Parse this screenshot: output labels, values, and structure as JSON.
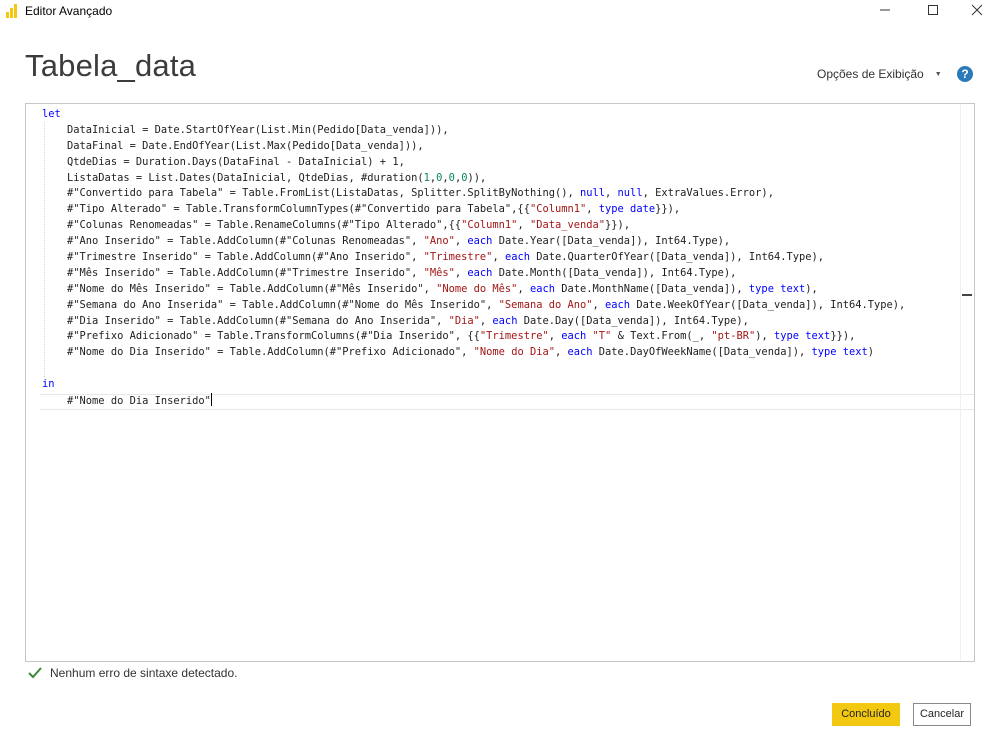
{
  "window": {
    "title": "Editor Avançado",
    "controls": [
      "minimize",
      "maximize",
      "close"
    ]
  },
  "header": {
    "query_name": "Tabela_data",
    "display_options_label": "Opções de Exibição",
    "help_label": "?"
  },
  "editor": {
    "lines": [
      [
        {
          "t": "let",
          "c": "kw"
        }
      ],
      [
        {
          "t": "    DataInicial = Date.StartOfYear(List.Min(Pedido[Data_venda])),"
        }
      ],
      [
        {
          "t": "    DataFinal = Date.EndOfYear(List.Max(Pedido[Data_venda])),"
        }
      ],
      [
        {
          "t": "    QtdeDias = Duration.Days(DataFinal - DataInicial) + 1,"
        }
      ],
      [
        {
          "t": "    ListaDatas = List.Dates(DataInicial, QtdeDias, #duration("
        },
        {
          "t": "1",
          "c": "num"
        },
        {
          "t": ","
        },
        {
          "t": "0",
          "c": "num"
        },
        {
          "t": ","
        },
        {
          "t": "0",
          "c": "num"
        },
        {
          "t": ","
        },
        {
          "t": "0",
          "c": "num"
        },
        {
          "t": ")),"
        }
      ],
      [
        {
          "t": "    #\"Convertido para Tabela\" = Table.FromList(ListaDatas, Splitter.SplitByNothing(), "
        },
        {
          "t": "null",
          "c": "kw"
        },
        {
          "t": ", "
        },
        {
          "t": "null",
          "c": "kw"
        },
        {
          "t": ", ExtraValues.Error),"
        }
      ],
      [
        {
          "t": "    #\"Tipo Alterado\" = Table.TransformColumnTypes(#\"Convertido para Tabela\",{{"
        },
        {
          "t": "\"Column1\"",
          "c": "str"
        },
        {
          "t": ", "
        },
        {
          "t": "type date",
          "c": "kw"
        },
        {
          "t": "}}),"
        }
      ],
      [
        {
          "t": "    #\"Colunas Renomeadas\" = Table.RenameColumns(#\"Tipo Alterado\",{{"
        },
        {
          "t": "\"Column1\"",
          "c": "str"
        },
        {
          "t": ", "
        },
        {
          "t": "\"Data_venda\"",
          "c": "str"
        },
        {
          "t": "}}),"
        }
      ],
      [
        {
          "t": "    #\"Ano Inserido\" = Table.AddColumn(#\"Colunas Renomeadas\", "
        },
        {
          "t": "\"Ano\"",
          "c": "str"
        },
        {
          "t": ", "
        },
        {
          "t": "each",
          "c": "kw"
        },
        {
          "t": " Date.Year([Data_venda]), Int64.Type),"
        }
      ],
      [
        {
          "t": "    #\"Trimestre Inserido\" = Table.AddColumn(#\"Ano Inserido\", "
        },
        {
          "t": "\"Trimestre\"",
          "c": "str"
        },
        {
          "t": ", "
        },
        {
          "t": "each",
          "c": "kw"
        },
        {
          "t": " Date.QuarterOfYear([Data_venda]), Int64.Type),"
        }
      ],
      [
        {
          "t": "    #\"Mês Inserido\" = Table.AddColumn(#\"Trimestre Inserido\", "
        },
        {
          "t": "\"Mês\"",
          "c": "str"
        },
        {
          "t": ", "
        },
        {
          "t": "each",
          "c": "kw"
        },
        {
          "t": " Date.Month([Data_venda]), Int64.Type),"
        }
      ],
      [
        {
          "t": "    #\"Nome do Mês Inserido\" = Table.AddColumn(#\"Mês Inserido\", "
        },
        {
          "t": "\"Nome do Mês\"",
          "c": "str"
        },
        {
          "t": ", "
        },
        {
          "t": "each",
          "c": "kw"
        },
        {
          "t": " Date.MonthName([Data_venda]), "
        },
        {
          "t": "type text",
          "c": "kw"
        },
        {
          "t": "),"
        }
      ],
      [
        {
          "t": "    #\"Semana do Ano Inserida\" = Table.AddColumn(#\"Nome do Mês Inserido\", "
        },
        {
          "t": "\"Semana do Ano\"",
          "c": "str"
        },
        {
          "t": ", "
        },
        {
          "t": "each",
          "c": "kw"
        },
        {
          "t": " Date.WeekOfYear([Data_venda]), Int64.Type),"
        }
      ],
      [
        {
          "t": "    #\"Dia Inserido\" = Table.AddColumn(#\"Semana do Ano Inserida\", "
        },
        {
          "t": "\"Dia\"",
          "c": "str"
        },
        {
          "t": ", "
        },
        {
          "t": "each",
          "c": "kw"
        },
        {
          "t": " Date.Day([Data_venda]), Int64.Type),"
        }
      ],
      [
        {
          "t": "    #\"Prefixo Adicionado\" = Table.TransformColumns(#\"Dia Inserido\", {{"
        },
        {
          "t": "\"Trimestre\"",
          "c": "str"
        },
        {
          "t": ", "
        },
        {
          "t": "each",
          "c": "kw"
        },
        {
          "t": " "
        },
        {
          "t": "\"T\"",
          "c": "str"
        },
        {
          "t": " & Text.From(_, "
        },
        {
          "t": "\"pt-BR\"",
          "c": "str"
        },
        {
          "t": "), "
        },
        {
          "t": "type text",
          "c": "kw"
        },
        {
          "t": "}}),"
        }
      ],
      [
        {
          "t": "    #\"Nome do Dia Inserido\" = Table.AddColumn(#\"Prefixo Adicionado\", "
        },
        {
          "t": "\"Nome do Dia\"",
          "c": "str"
        },
        {
          "t": ", "
        },
        {
          "t": "each",
          "c": "kw"
        },
        {
          "t": " Date.DayOfWeekName([Data_venda]), "
        },
        {
          "t": "type text",
          "c": "kw"
        },
        {
          "t": ")"
        }
      ],
      [
        {
          "t": ""
        }
      ],
      [
        {
          "t": "in",
          "c": "kw"
        }
      ],
      [
        {
          "t": "    #\"Nome do Dia Inserido\""
        }
      ]
    ]
  },
  "status": {
    "message": "Nenhum erro de sintaxe detectado.",
    "icon": "checkmark-icon",
    "color": "#3a8a3a"
  },
  "footer": {
    "done_label": "Concluído",
    "cancel_label": "Cancelar"
  },
  "colors": {
    "accent": "#f2c811",
    "help": "#2a7ab8"
  }
}
